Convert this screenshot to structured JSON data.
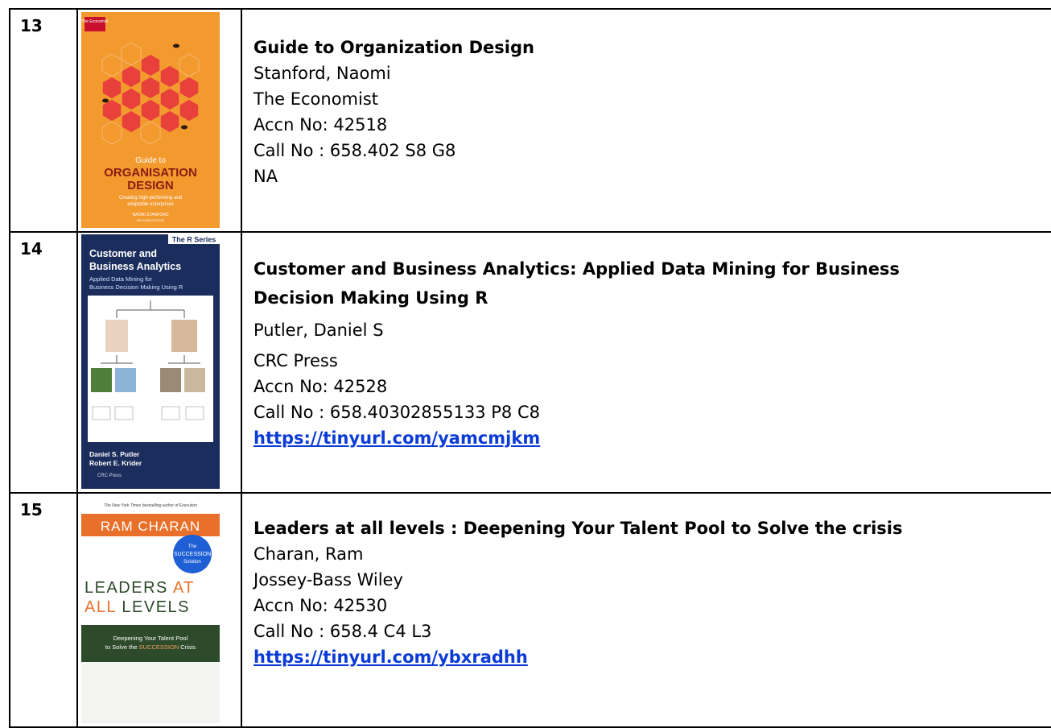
{
  "rows": [
    {
      "number": "13",
      "title": "Guide to Organization Design",
      "author": "Stanford, Naomi",
      "publisher": "The Economist",
      "accn": "Accn No: 42518",
      "call": "Call No  : 658.402 S8 G8",
      "link": "NA",
      "cover": {
        "brand": "The Economist",
        "line1": "Guide to",
        "line2": "ORGANISATION",
        "line3": "DESIGN",
        "subtitle1": "Creating high-performing and",
        "subtitle2": "adaptable enterprises",
        "author": "NAOMI STANFORD",
        "edition": "SECOND EDITION",
        "colors": {
          "background": "#f39a2f",
          "hex": "#e8403a",
          "brand": "#c8102e"
        }
      }
    },
    {
      "number": "14",
      "title_line1": "Customer and Business Analytics: Applied Data Mining for Business",
      "title_line2": "Decision Making Using R",
      "author": "Putler, Daniel S",
      "publisher": "CRC Press",
      "accn": "Accn No: 42528",
      "call": "Call No  : 658.40302855133 P8 C8",
      "link": "https://tinyurl.com/yamcmjkm",
      "cover": {
        "series": "The R Series",
        "title1": "Customer and",
        "title2": "Business Analytics",
        "sub1": "Applied Data Mining for",
        "sub2": "Business Decision Making Using R",
        "author1": "Daniel S. Putler",
        "author2": "Robert E. Krider",
        "press": "CRC Press",
        "colors": {
          "background": "#1b2d5c",
          "accent": "#ffffff"
        }
      }
    },
    {
      "number": "15",
      "title": "Leaders at all levels : Deepening Your Talent Pool to Solve the crisis",
      "author": "Charan, Ram",
      "publisher": "Jossey-Bass Wiley",
      "accn": "Accn No: 42530",
      "call": "Call No  : 658.4 C4 L3",
      "link": "https://tinyurl.com/ybxradhh",
      "cover": {
        "tagline": "The New York Times bestselling author of Execution",
        "author": "RAM CHARAN",
        "badge1": "The",
        "badge2": "SUCCESSION",
        "badge3": "Solution",
        "title1a": "LEADERS ",
        "title1b": "AT",
        "title2a": "ALL ",
        "title2b": "LEVELS",
        "sub1": "Deepening Your Talent Pool",
        "sub2a": "to Solve the ",
        "sub2b": "SUCCESSION",
        "sub2c": " Crisis",
        "colors": {
          "banner": "#e8702a",
          "badge": "#1f5fd6",
          "band": "#2d4a2a"
        }
      }
    }
  ]
}
